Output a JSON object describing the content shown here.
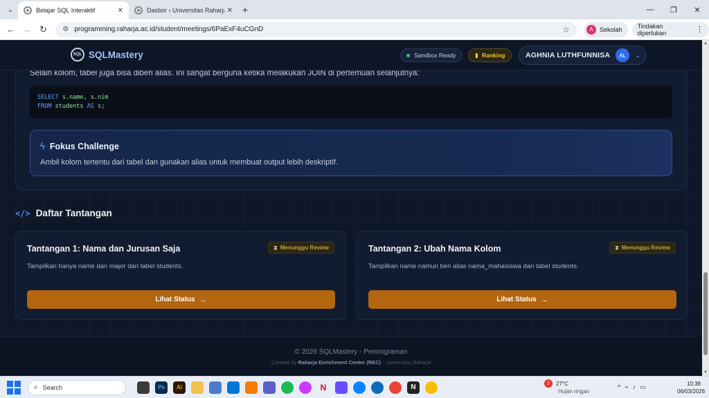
{
  "browser": {
    "tabs": [
      {
        "title": "Belajar SQL Interaktif",
        "active": true
      },
      {
        "title": "Dasbor ‹ Universitas Raharja —",
        "active": false
      }
    ],
    "url": "programming.raharja.ac.id/student/meetings/6PaExF4uCGnD",
    "profile_initial": "A",
    "profile_label": "Sekolah",
    "action_label": "Tindakan diperlukan"
  },
  "header": {
    "logo_mark": "SQL",
    "logo_text": "SQLMastery",
    "sandbox_label": "Sandbox Ready",
    "ranking_label": "Ranking",
    "user_name": "AGHNIA LUTHFUNNISA",
    "user_initials": "AL"
  },
  "lesson": {
    "intro": "Selain kolom, tabel juga bisa diberi alias. Ini sangat berguna ketika melakukan JOIN di pertemuan selanjutnya:",
    "code": {
      "line1": {
        "kw1": "SELECT",
        "t1": "s.name",
        "p1": ", ",
        "t2": "s.nim"
      },
      "line2": {
        "kw1": "FROM",
        "t1": "students",
        "kw2": "AS",
        "t2": "s",
        "p1": ";"
      }
    },
    "focus_title": "Fokus Challenge",
    "focus_desc": "Ambil kolom tertentu dari tabel dan gunakan alias untuk membuat output lebih deskriptif."
  },
  "challenges": {
    "section_title": "Daftar Tantangan",
    "items": [
      {
        "title": "Tantangan 1: Nama dan Jurusan Saja",
        "status": "Menunggu Review",
        "desc": "Tampilkan hanya name dan major dari tabel students.",
        "button": "Lihat Status"
      },
      {
        "title": "Tantangan 2: Ubah Nama Kolom",
        "status": "Menunggu Review",
        "desc": "Tampilkan name namun beri alias nama_mahasiswa dari tabel students.",
        "button": "Lihat Status"
      }
    ]
  },
  "footer": {
    "copyright": "© 2026 SQLMastery - Pemrograman",
    "created_prefix": "Created by",
    "created_org": "Raharja Enrichment Center (REC)",
    "created_sep": " - ",
    "created_univ": "Universitas Raharja"
  },
  "taskbar": {
    "search_placeholder": "Search",
    "weather_badge": "2",
    "weather_temp": "27°C",
    "weather_desc": "Hujan ringan",
    "time": "10:38",
    "date": "06/03/2026"
  },
  "colors": {
    "accent": "#4f8ff7",
    "button": "#b3650f",
    "status": "#c9a13a"
  }
}
